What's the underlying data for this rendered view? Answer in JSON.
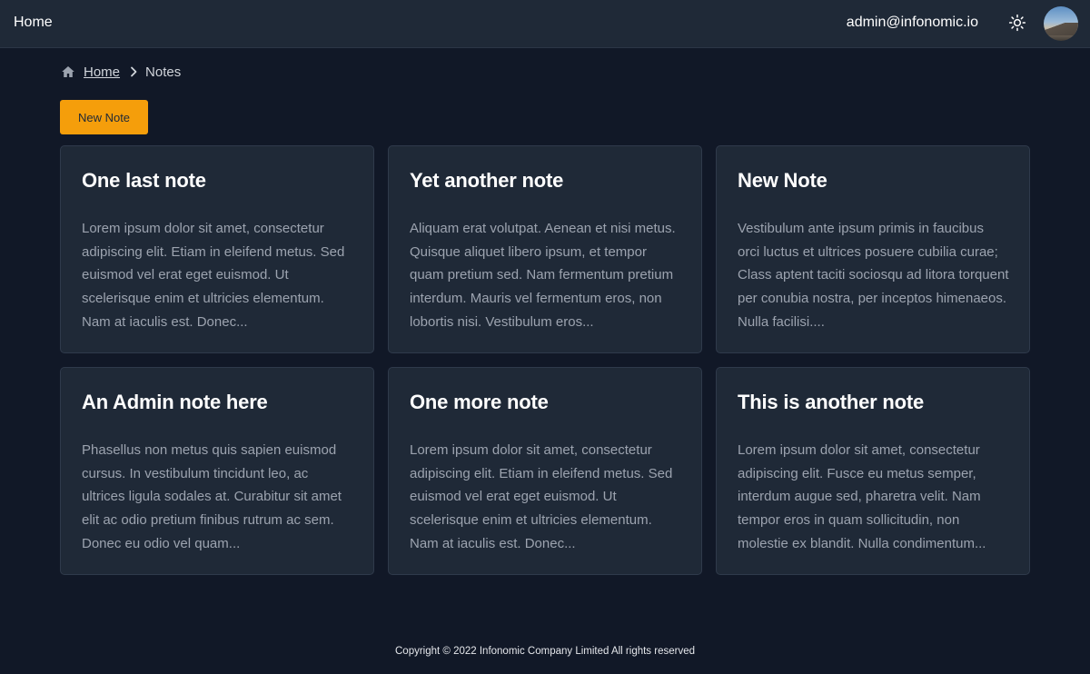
{
  "nav": {
    "brand": "Home",
    "user_email": "admin@infonomic.io",
    "theme_icon": "sun-icon",
    "avatar_icon": "avatar-photo"
  },
  "breadcrumb": {
    "home_label": "Home",
    "current": "Notes"
  },
  "actions": {
    "new_note_label": "New Note",
    "accent": "#f59e0b"
  },
  "notes": [
    {
      "title": "One last note",
      "excerpt": "Lorem ipsum dolor sit amet, consectetur adipiscing elit. Etiam in eleifend metus. Sed euismod vel erat eget euismod. Ut scelerisque enim et ultricies elementum. Nam at iaculis est. Donec..."
    },
    {
      "title": "Yet another note",
      "excerpt": "Aliquam erat volutpat. Aenean et nisi metus. Quisque aliquet libero ipsum, et tempor quam pretium sed. Nam fermentum pretium interdum. Mauris vel fermentum eros, non lobortis nisi. Vestibulum eros..."
    },
    {
      "title": "New Note",
      "excerpt": "Vestibulum ante ipsum primis in faucibus orci luctus et ultrices posuere cubilia curae; Class aptent taciti sociosqu ad litora torquent per conubia nostra, per inceptos himenaeos. Nulla facilisi...."
    },
    {
      "title": "An Admin note here",
      "excerpt": "Phasellus non metus quis sapien euismod cursus. In vestibulum tincidunt leo, ac ultrices ligula sodales at. Curabitur sit amet elit ac odio pretium finibus rutrum ac sem. Donec eu odio vel quam..."
    },
    {
      "title": "One more note",
      "excerpt": "Lorem ipsum dolor sit amet, consectetur adipiscing elit. Etiam in eleifend metus. Sed euismod vel erat eget euismod. Ut scelerisque enim et ultricies elementum. Nam at iaculis est. Donec..."
    },
    {
      "title": "This is another note",
      "excerpt": "Lorem ipsum dolor sit amet, consectetur adipiscing elit. Fusce eu metus semper, interdum augue sed, pharetra velit. Nam tempor eros in quam sollicitudin, non molestie ex blandit. Nulla condimentum..."
    }
  ],
  "footer": {
    "copyright": "Copyright © 2022 Infonomic Company Limited All rights reserved"
  }
}
